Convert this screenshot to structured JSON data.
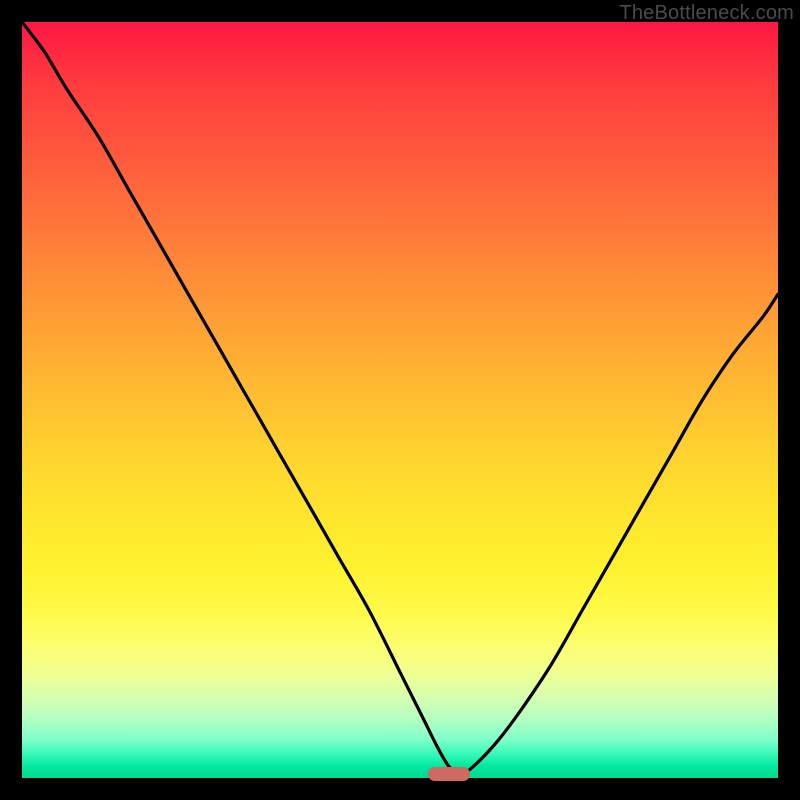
{
  "watermark": "TheBottleneck.com",
  "colors": {
    "frame": "#000000",
    "curve": "#000000",
    "marker": "#cf6a62"
  },
  "chart_data": {
    "type": "line",
    "title": "",
    "xlabel": "",
    "ylabel": "",
    "xlim": [
      0,
      100
    ],
    "ylim": [
      0,
      100
    ],
    "note": "axes unlabeled; values estimated from pixel positions on a 0-100 scale (bottom=0, top=100)",
    "series": [
      {
        "name": "curve",
        "x": [
          0,
          3,
          6,
          10,
          14,
          18,
          22,
          26,
          30,
          34,
          38,
          42,
          46,
          50,
          53,
          55,
          56.5,
          58,
          60,
          63,
          66,
          70,
          74,
          78,
          82,
          86,
          90,
          94,
          98,
          100
        ],
        "y": [
          100,
          96,
          91,
          85,
          78,
          71,
          64,
          57,
          50,
          43,
          36,
          29,
          22,
          14,
          8,
          4,
          1.5,
          0.5,
          1.8,
          5,
          9,
          15,
          22,
          29,
          36,
          43,
          50,
          56,
          61,
          64
        ]
      }
    ],
    "marker": {
      "x": 56.5,
      "y": 0.5,
      "width_pct": 5.5,
      "height_pct": 1.8
    }
  }
}
